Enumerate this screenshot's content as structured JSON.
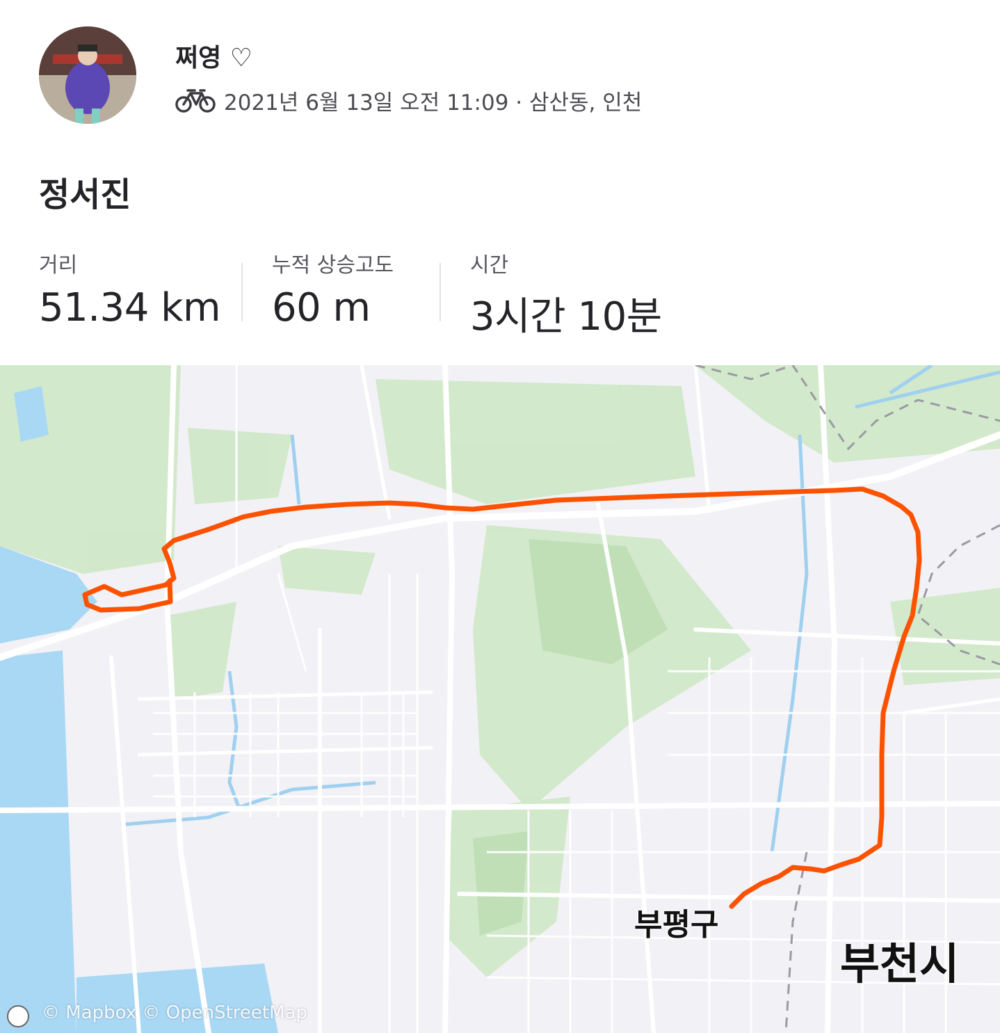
{
  "header": {
    "user_name": "쩌영 ♡",
    "activity_meta": "2021년 6월 13일 오전 11:09 · 삼산동, 인천",
    "activity_icon": "bike-icon",
    "activity_title": "정서진"
  },
  "stats": [
    {
      "label": "거리",
      "value": "51.34 km"
    },
    {
      "label": "누적 상승고도",
      "value": "60 m"
    },
    {
      "label": "시간",
      "value": "3시간 10분"
    }
  ],
  "map": {
    "labels": {
      "district": "부평구",
      "city": "부천시"
    },
    "attribution": "© Mapbox © OpenStreetMap",
    "colors": {
      "route": "#fc5200",
      "water": "#a9d8f5",
      "park": "#c8e6c0",
      "land": "#f2f1f6",
      "road": "#ffffff"
    }
  }
}
